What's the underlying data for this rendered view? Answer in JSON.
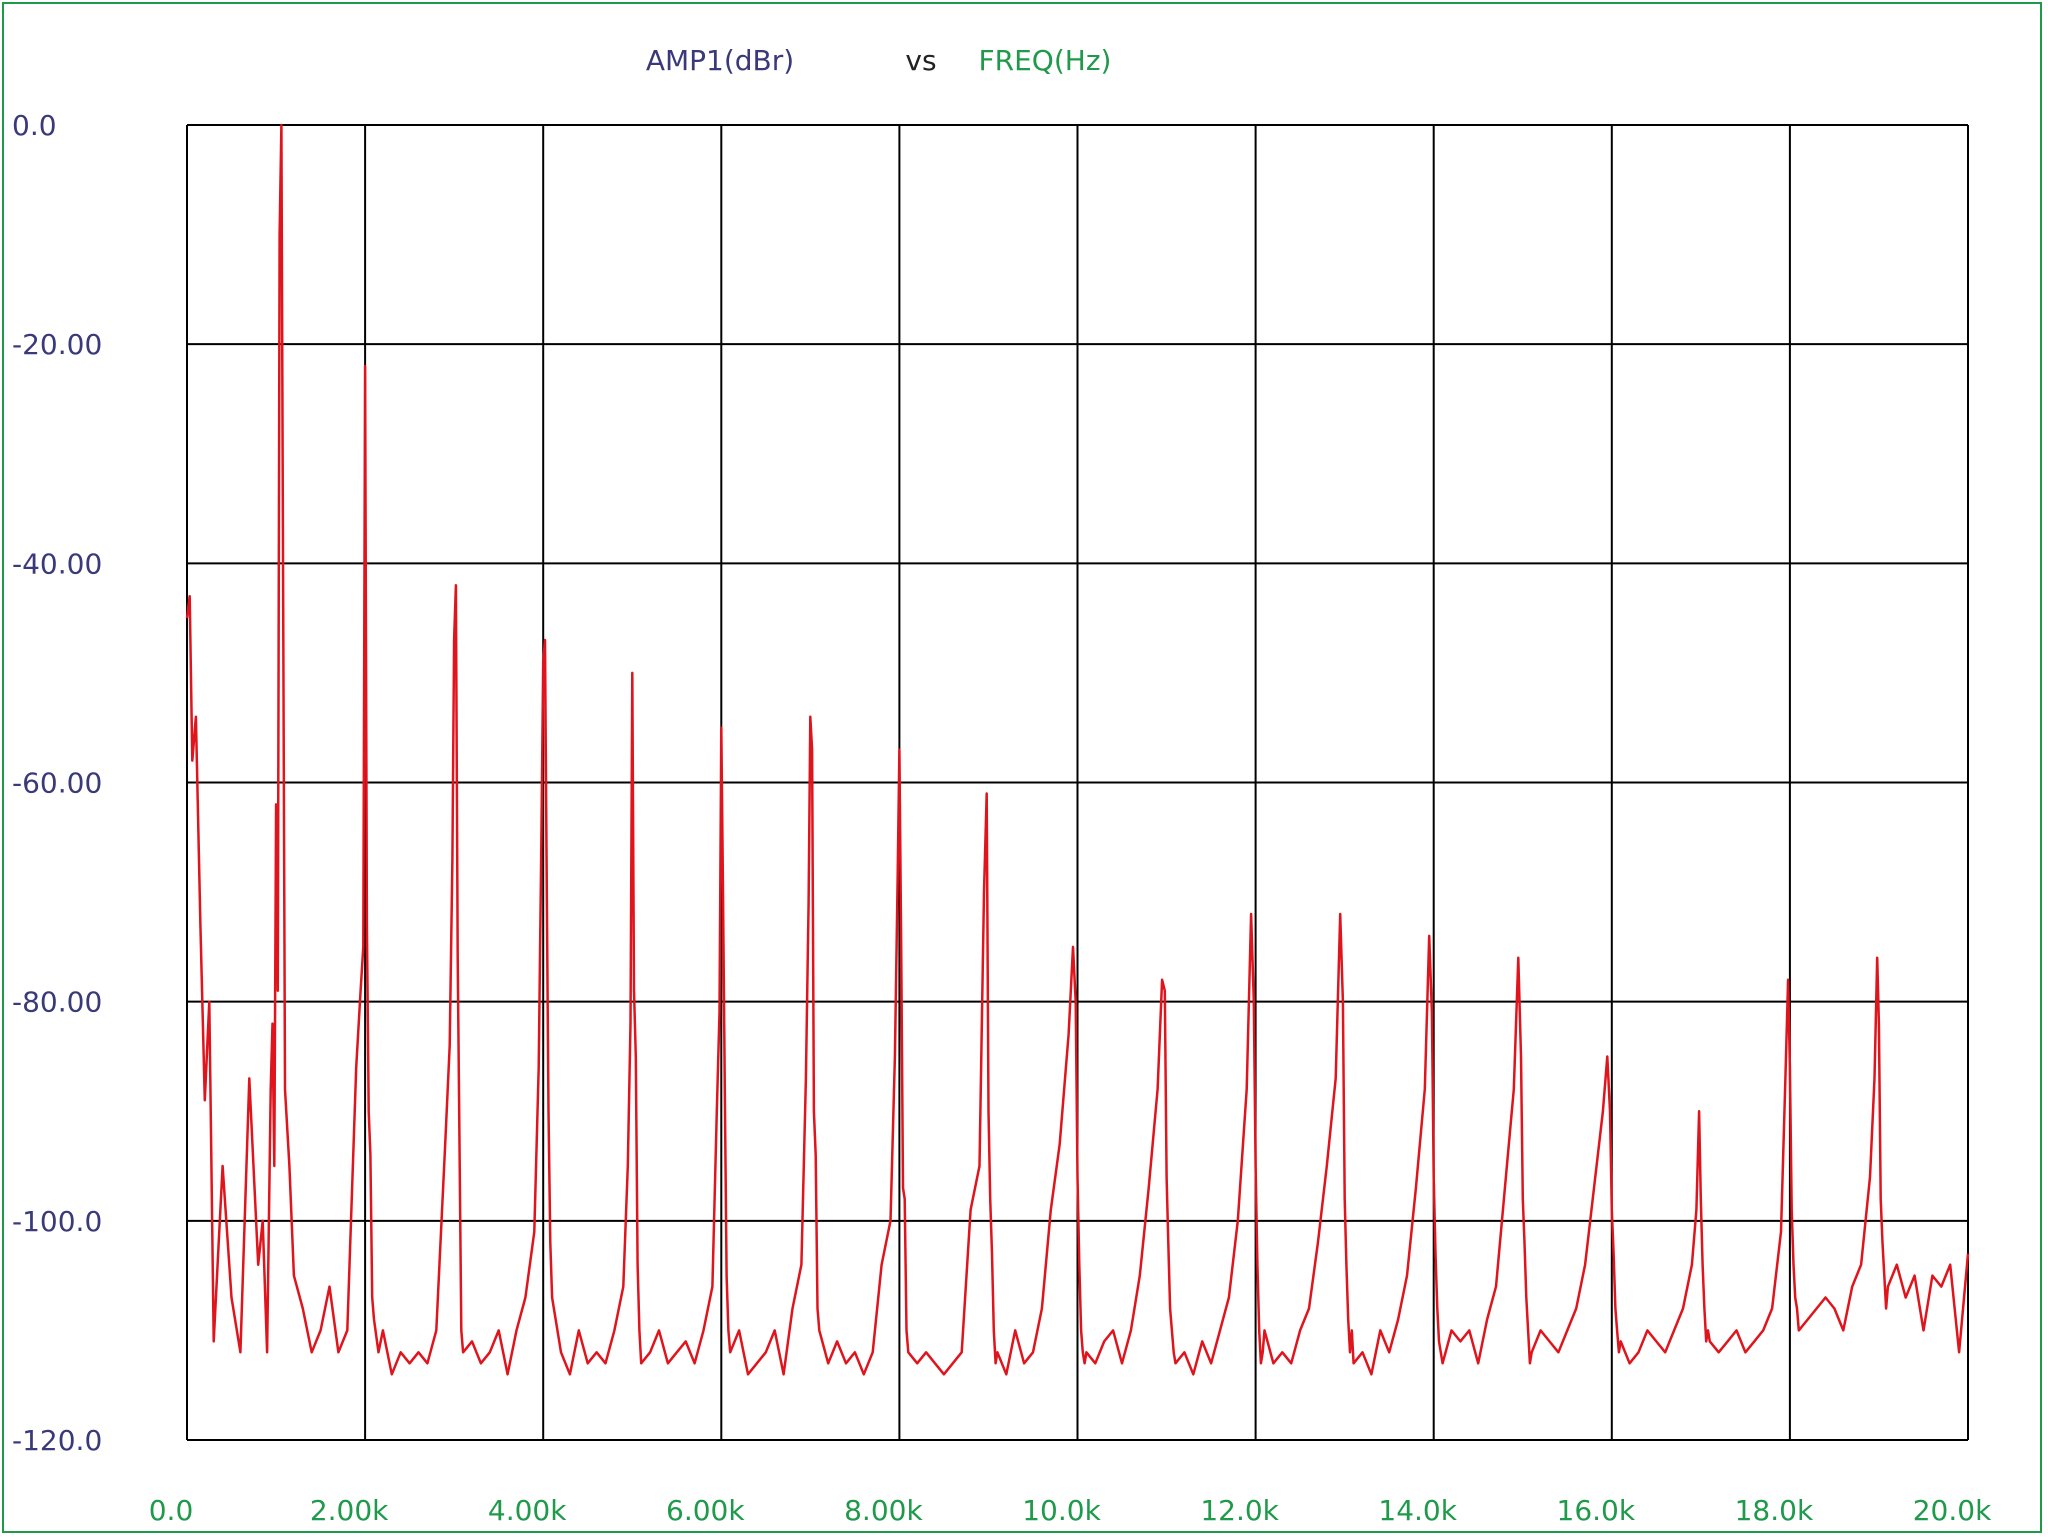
{
  "chart_data": {
    "type": "line",
    "title_parts": {
      "y_name": "AMP1(dBr)",
      "separator": "vs",
      "x_name": "FREQ(Hz)"
    },
    "colors": {
      "y_title": "#3a3a7a",
      "separator": "#222222",
      "x_title": "#1f9a4a",
      "y_ticks": "#3a3a7a",
      "x_ticks": "#1f9a4a",
      "line": "#e0141c",
      "grid": "#000000",
      "frame": "#1f9a4a"
    },
    "xlim": [
      0,
      20000
    ],
    "ylim": [
      -120,
      0
    ],
    "x_tick_values": [
      0,
      2000,
      4000,
      6000,
      8000,
      10000,
      12000,
      14000,
      16000,
      18000,
      20000
    ],
    "x_tick_labels": [
      "0.0",
      "2.00k",
      "4.00k",
      "6.00k",
      "8.00k",
      "10.0k",
      "12.0k",
      "14.0k",
      "16.0k",
      "18.0k",
      "20.0k"
    ],
    "y_tick_values": [
      0,
      -20,
      -40,
      -60,
      -80,
      -100,
      -120
    ],
    "y_tick_labels": [
      "0.0",
      "-20.00",
      "-40.00",
      "-60.00",
      "-80.00",
      "-100.0",
      "-120.0"
    ],
    "grid": true,
    "series": [
      {
        "x": [
          0,
          30,
          60,
          100,
          150,
          200,
          250,
          300,
          400,
          500,
          600,
          700,
          800,
          850,
          900,
          940,
          960,
          980,
          1000,
          1020,
          1040,
          1060,
          1080,
          1100,
          1150,
          1200,
          1300,
          1400,
          1500,
          1600,
          1700,
          1800,
          1900,
          1950,
          1980,
          2000,
          2020,
          2040,
          2060,
          2080,
          2100,
          2150,
          2200,
          2300,
          2400,
          2500,
          2600,
          2700,
          2800,
          2900,
          2950,
          2980,
          3000,
          3020,
          3040,
          3060,
          3080,
          3100,
          3200,
          3300,
          3400,
          3500,
          3600,
          3700,
          3800,
          3900,
          3950,
          3980,
          4000,
          4020,
          4040,
          4060,
          4080,
          4100,
          4200,
          4300,
          4400,
          4500,
          4600,
          4700,
          4800,
          4900,
          4950,
          4980,
          5000,
          5020,
          5040,
          5060,
          5080,
          5100,
          5200,
          5300,
          5400,
          5500,
          5600,
          5700,
          5800,
          5900,
          5950,
          5980,
          6000,
          6020,
          6040,
          6060,
          6080,
          6100,
          6200,
          6300,
          6400,
          6500,
          6600,
          6700,
          6800,
          6900,
          6950,
          6980,
          7000,
          7020,
          7040,
          7060,
          7080,
          7100,
          7200,
          7300,
          7400,
          7500,
          7600,
          7700,
          7800,
          7900,
          7950,
          7980,
          8000,
          8020,
          8040,
          8060,
          8080,
          8100,
          8200,
          8300,
          8400,
          8500,
          8600,
          8700,
          8800,
          8900,
          8950,
          8980,
          9000,
          9020,
          9040,
          9060,
          9080,
          9100,
          9200,
          9300,
          9400,
          9500,
          9600,
          9700,
          9800,
          9900,
          9950,
          9980,
          10000,
          10020,
          10040,
          10060,
          10080,
          10100,
          10200,
          10300,
          10400,
          10500,
          10600,
          10700,
          10800,
          10900,
          10950,
          10980,
          11000,
          11020,
          11040,
          11060,
          11080,
          11100,
          11200,
          11300,
          11400,
          11500,
          11600,
          11700,
          11800,
          11900,
          11950,
          11980,
          12000,
          12020,
          12040,
          12060,
          12080,
          12100,
          12200,
          12300,
          12400,
          12500,
          12600,
          12700,
          12800,
          12900,
          12950,
          12980,
          13000,
          13020,
          13040,
          13060,
          13080,
          13100,
          13200,
          13300,
          13400,
          13500,
          13600,
          13700,
          13800,
          13900,
          13950,
          13980,
          14000,
          14020,
          14040,
          14060,
          14080,
          14100,
          14200,
          14300,
          14400,
          14500,
          14600,
          14700,
          14800,
          14900,
          14950,
          14980,
          15000,
          15020,
          15040,
          15060,
          15080,
          15100,
          15200,
          15300,
          15400,
          15500,
          15600,
          15700,
          15800,
          15900,
          15950,
          15980,
          16000,
          16020,
          16040,
          16060,
          16080,
          16100,
          16200,
          16300,
          16400,
          16500,
          16600,
          16700,
          16800,
          16900,
          16950,
          16980,
          17000,
          17020,
          17040,
          17060,
          17080,
          17100,
          17200,
          17300,
          17400,
          17500,
          17600,
          17700,
          17800,
          17900,
          17950,
          17980,
          18000,
          18020,
          18040,
          18060,
          18080,
          18100,
          18200,
          18300,
          18400,
          18500,
          18600,
          18700,
          18800,
          18900,
          18950,
          18980,
          19000,
          19020,
          19040,
          19060,
          19080,
          19100,
          19200,
          19300,
          19400,
          19500,
          19600,
          19700,
          19800,
          19900,
          20000
        ],
        "values": [
          -45,
          -43,
          -58,
          -54,
          -73,
          -89,
          -80,
          -111,
          -95,
          -107,
          -112,
          -87,
          -104,
          -100,
          -112,
          -88,
          -82,
          -95,
          -62,
          -79,
          -10,
          0,
          -44,
          -88,
          -95,
          -105,
          -108,
          -112,
          -110,
          -106,
          -112,
          -110,
          -86,
          -79,
          -75,
          -22,
          -73,
          -90,
          -94,
          -107,
          -109,
          -112,
          -110,
          -114,
          -112,
          -113,
          -112,
          -113,
          -110,
          -93,
          -84,
          -67,
          -47,
          -42,
          -76,
          -93,
          -110,
          -112,
          -111,
          -113,
          -112,
          -110,
          -114,
          -110,
          -107,
          -101,
          -86,
          -65,
          -49,
          -47,
          -70,
          -90,
          -102,
          -107,
          -112,
          -114,
          -110,
          -113,
          -112,
          -113,
          -110,
          -106,
          -95,
          -82,
          -50,
          -79,
          -85,
          -104,
          -110,
          -113,
          -112,
          -110,
          -113,
          -112,
          -111,
          -113,
          -110,
          -106,
          -90,
          -81,
          -55,
          -71,
          -89,
          -105,
          -110,
          -112,
          -110,
          -114,
          -113,
          -112,
          -110,
          -114,
          -108,
          -104,
          -87,
          -71,
          -54,
          -57,
          -90,
          -94,
          -108,
          -110,
          -113,
          -111,
          -113,
          -112,
          -114,
          -112,
          -104,
          -100,
          -85,
          -69,
          -57,
          -75,
          -97,
          -98,
          -110,
          -112,
          -113,
          -112,
          -113,
          -114,
          -113,
          -112,
          -99,
          -95,
          -70,
          -61,
          -90,
          -98,
          -103,
          -110,
          -113,
          -112,
          -114,
          -110,
          -113,
          -112,
          -108,
          -99,
          -93,
          -83,
          -75,
          -80,
          -96,
          -104,
          -110,
          -112,
          -113,
          -112,
          -113,
          -111,
          -110,
          -113,
          -110,
          -105,
          -97,
          -88,
          -78,
          -79,
          -96,
          -102,
          -108,
          -110,
          -112,
          -113,
          -112,
          -114,
          -111,
          -113,
          -110,
          -107,
          -100,
          -88,
          -72,
          -80,
          -95,
          -104,
          -110,
          -113,
          -112,
          -110,
          -113,
          -112,
          -113,
          -110,
          -108,
          -102,
          -95,
          -87,
          -72,
          -80,
          -98,
          -104,
          -109,
          -112,
          -110,
          -113,
          -112,
          -114,
          -110,
          -112,
          -109,
          -105,
          -97,
          -88,
          -74,
          -81,
          -96,
          -103,
          -108,
          -111,
          -112,
          -113,
          -110,
          -111,
          -110,
          -113,
          -109,
          -106,
          -97,
          -88,
          -76,
          -85,
          -98,
          -102,
          -107,
          -110,
          -113,
          -112,
          -110,
          -111,
          -112,
          -110,
          -108,
          -104,
          -97,
          -90,
          -85,
          -90,
          -99,
          -103,
          -108,
          -110,
          -112,
          -111,
          -113,
          -112,
          -110,
          -111,
          -112,
          -110,
          -108,
          -104,
          -99,
          -90,
          -98,
          -104,
          -108,
          -111,
          -110,
          -111,
          -112,
          -111,
          -110,
          -112,
          -111,
          -110,
          -108,
          -101,
          -87,
          -78,
          -86,
          -99,
          -104,
          -107,
          -108,
          -110,
          -109,
          -108,
          -107,
          -108,
          -110,
          -106,
          -104,
          -96,
          -87,
          -76,
          -82,
          -98,
          -102,
          -105,
          -108,
          -106,
          -104,
          -107,
          -105,
          -110,
          -105,
          -106,
          -104,
          -112,
          -103
        ]
      }
    ]
  }
}
